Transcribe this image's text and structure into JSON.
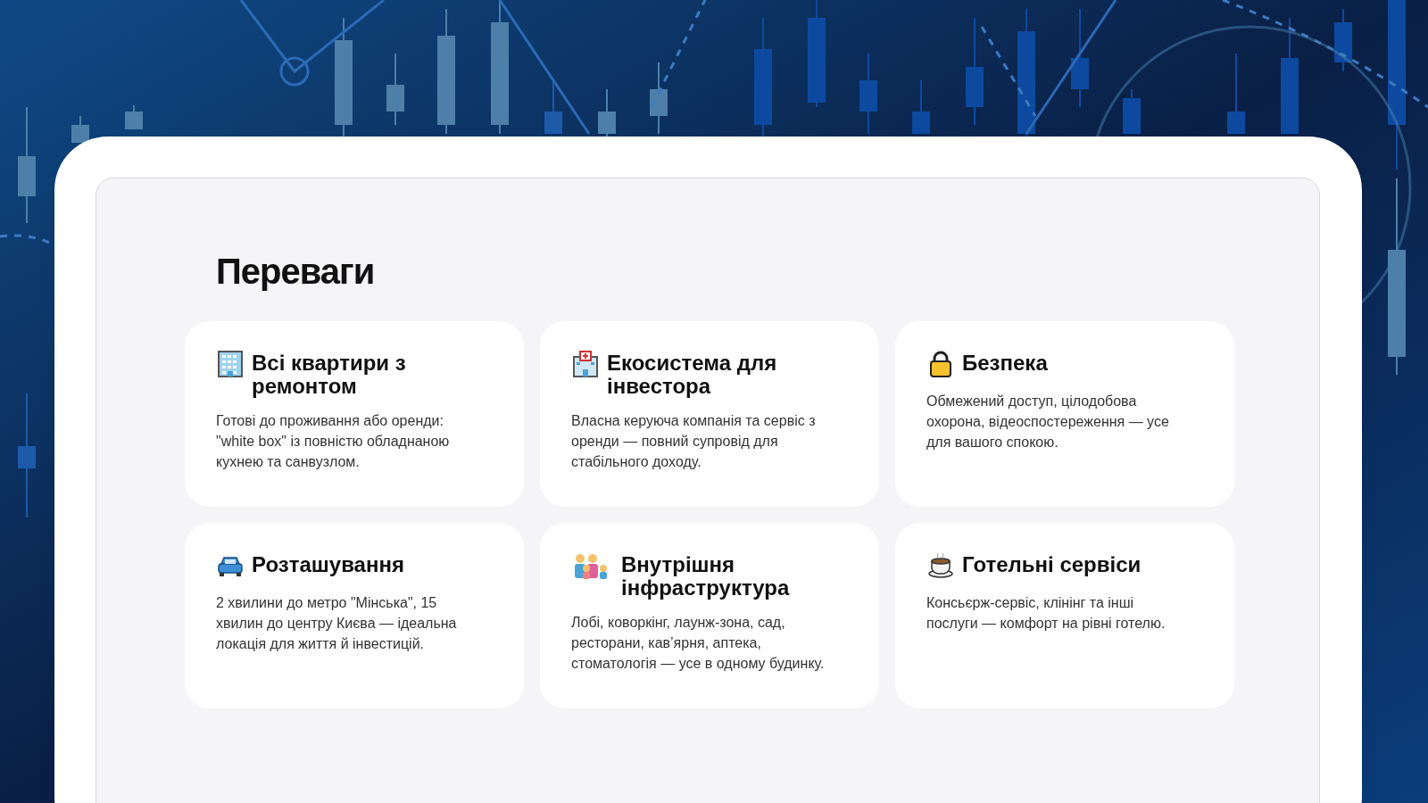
{
  "section": {
    "title": "Переваги"
  },
  "cards": [
    {
      "kind": "building",
      "title": "Всі квартири з ремонтом",
      "text": "Готові до проживання або оренди: \"white box\" із повністю обладнаною кухнею та санвузлом."
    },
    {
      "kind": "hospital",
      "title": "Екосистема для інвестора",
      "text": "Власна керуюча компанія та сервіс з оренди — повний супровід для стабільного доходу."
    },
    {
      "kind": "lock",
      "title": "Безпека",
      "text": "Обмежений доступ, цілодобова охорона, відеоспостереження — усе для вашого спокою."
    },
    {
      "kind": "car",
      "title": "Розташування",
      "text": "2 хвилини до метро \"Мінська\", 15 хвилин до центру Києва — ідеальна локація для життя й інвестицій."
    },
    {
      "kind": "family",
      "title": "Внутрішня інфраструктура",
      "text": "Лобі, коворкінг, лаунж-зона, сад, ресторани, кав’ярня, аптека, стоматологія — усе в одному будинку."
    },
    {
      "kind": "coffee",
      "title": "Готельні сервіси",
      "text": "Консьєрж-сервіс, клінінг та інші послуги — комфорт на рівні готелю."
    }
  ]
}
